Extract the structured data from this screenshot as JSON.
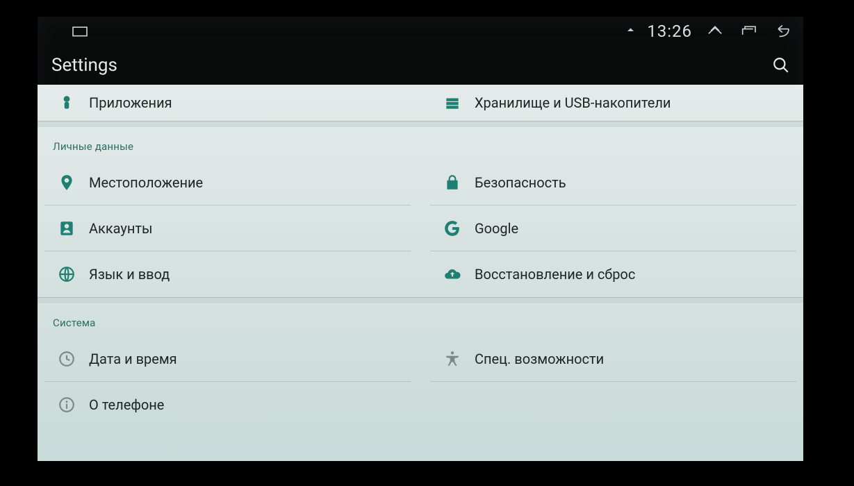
{
  "status": {
    "time": "13:26"
  },
  "page": {
    "title": "Settings"
  },
  "top": {
    "left": {
      "label": "Приложения"
    },
    "right": {
      "label": "Хранилище и USB-накопители"
    }
  },
  "sections": {
    "personal": {
      "header": "Личные данные",
      "rows": [
        {
          "left": {
            "label": "Местоположение"
          },
          "right": {
            "label": "Безопасность"
          }
        },
        {
          "left": {
            "label": "Аккаунты"
          },
          "right": {
            "label": "Google"
          }
        },
        {
          "left": {
            "label": "Язык и ввод"
          },
          "right": {
            "label": "Восстановление и сброс"
          }
        }
      ]
    },
    "system": {
      "header": "Система",
      "rows": [
        {
          "left": {
            "label": "Дата и время"
          },
          "right": {
            "label": "Спец. возможности"
          }
        },
        {
          "left": {
            "label": "О телефоне"
          },
          "right": null
        }
      ]
    }
  }
}
